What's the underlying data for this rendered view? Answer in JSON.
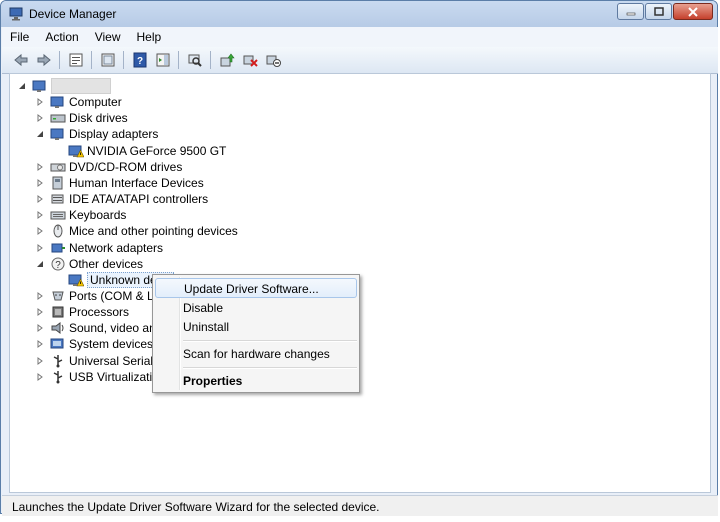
{
  "window": {
    "title": "Device Manager",
    "buttons": {
      "minimize": "minimize-icon",
      "maximize": "maximize-icon",
      "close": "close-icon"
    }
  },
  "menu": [
    "File",
    "Action",
    "View",
    "Help"
  ],
  "toolbar": [
    "back-icon",
    "forward-icon",
    "properties-icon",
    "show-hide-console-tree-icon",
    "help-icon",
    "show-action-pane-icon",
    "scan-hardware-icon",
    "update-driver-icon",
    "uninstall-icon",
    "disable-icon"
  ],
  "tree": {
    "root": "",
    "nodes": [
      {
        "label": "Computer",
        "icon": "computer-icon",
        "expanded": false,
        "children": []
      },
      {
        "label": "Disk drives",
        "icon": "disk-drive-icon",
        "expanded": false,
        "children": []
      },
      {
        "label": "Display adapters",
        "icon": "display-adapter-icon",
        "expanded": true,
        "children": [
          {
            "label": "NVIDIA GeForce 9500 GT",
            "icon": "display-adapter-warning-icon"
          }
        ]
      },
      {
        "label": "DVD/CD-ROM drives",
        "icon": "dvd-drive-icon",
        "expanded": false,
        "children": []
      },
      {
        "label": "Human Interface Devices",
        "icon": "hid-icon",
        "expanded": false,
        "children": []
      },
      {
        "label": "IDE ATA/ATAPI controllers",
        "icon": "ide-controller-icon",
        "expanded": false,
        "children": []
      },
      {
        "label": "Keyboards",
        "icon": "keyboard-icon",
        "expanded": false,
        "children": []
      },
      {
        "label": "Mice and other pointing devices",
        "icon": "mouse-icon",
        "expanded": false,
        "children": []
      },
      {
        "label": "Network adapters",
        "icon": "network-adapter-icon",
        "expanded": false,
        "children": []
      },
      {
        "label": "Other devices",
        "icon": "other-devices-icon",
        "expanded": true,
        "children": [
          {
            "label": "Unknown devic",
            "icon": "unknown-device-warning-icon"
          }
        ]
      },
      {
        "label": "Ports (COM & LPT",
        "icon": "port-icon",
        "expanded": false,
        "children": []
      },
      {
        "label": "Processors",
        "icon": "processor-icon",
        "expanded": false,
        "children": []
      },
      {
        "label": "Sound, video and",
        "icon": "sound-icon",
        "expanded": false,
        "children": []
      },
      {
        "label": "System devices",
        "icon": "system-devices-icon",
        "expanded": false,
        "children": []
      },
      {
        "label": "Universal Serial Bu",
        "icon": "usb-icon",
        "expanded": false,
        "children": []
      },
      {
        "label": "USB Virtualization",
        "icon": "usb-virtualization-icon",
        "expanded": false,
        "children": []
      }
    ]
  },
  "context_menu": {
    "items": [
      {
        "label": "Update Driver Software...",
        "highlighted": true
      },
      {
        "label": "Disable"
      },
      {
        "label": "Uninstall"
      },
      {
        "label": "Scan for hardware changes"
      },
      {
        "label": "Properties",
        "bold": true
      }
    ]
  },
  "status": "Launches the Update Driver Software Wizard for the selected device."
}
